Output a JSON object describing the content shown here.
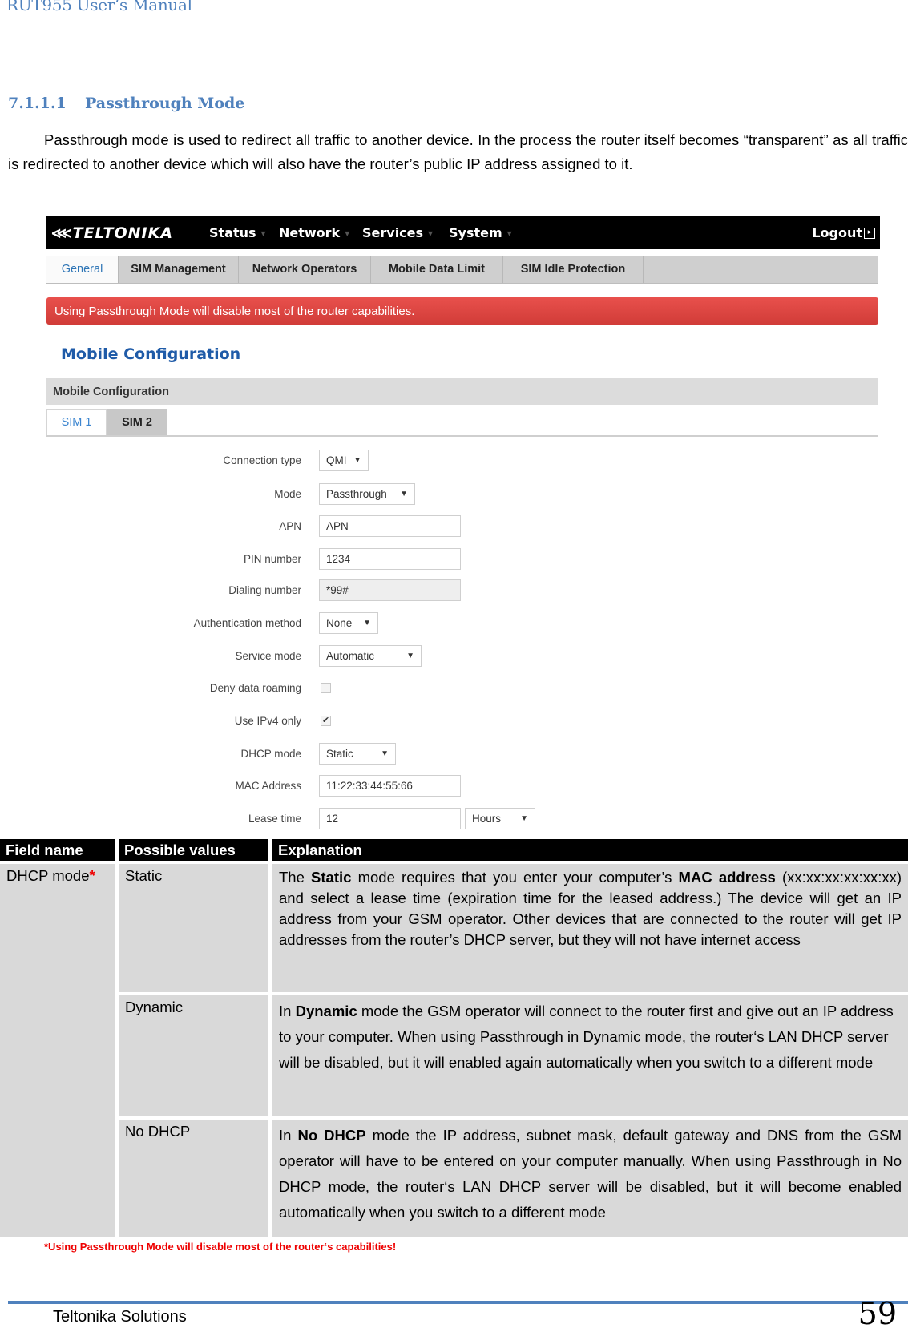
{
  "document": {
    "running_head": "RUT955 User‘s Manual",
    "section_number": "7.1.1.1",
    "section_title": "Passthrough Mode",
    "intro": "Passthrough mode is used to redirect all traffic to another device. In the process the router itself becomes “transparent” as all traffic is redirected to another device which will also have the router’s public IP address assigned to it.",
    "footnote": "*Using Passthrough Mode will disable most of the router‘s capabilities!",
    "footer_company": "Teltonika Solutions",
    "page_number": "59",
    "accent_color": "#4f81bd"
  },
  "router_ui": {
    "brand": "TELTONIKA",
    "nav": [
      {
        "label": "Status",
        "icon": "caret-down-icon"
      },
      {
        "label": "Network",
        "icon": "caret-down-icon"
      },
      {
        "label": "Services",
        "icon": "caret-down-icon"
      },
      {
        "label": "System",
        "icon": "caret-down-icon"
      }
    ],
    "logout": {
      "label": "Logout",
      "icon": "logout-icon"
    },
    "tabs": [
      {
        "label": "General",
        "active": true
      },
      {
        "label": "SIM Management",
        "active": false
      },
      {
        "label": "Network Operators",
        "active": false
      },
      {
        "label": "Mobile Data Limit",
        "active": false
      },
      {
        "label": "SIM Idle Protection",
        "active": false
      }
    ],
    "alert": "Using Passthrough Mode will disable most of the router capabilities.",
    "alert_color": "#d9443f",
    "page_title": "Mobile Configuration",
    "section_title": "Mobile Configuration",
    "sim_tabs": [
      {
        "label": "SIM 1",
        "active": true
      },
      {
        "label": "SIM 2",
        "active": false
      }
    ],
    "form": {
      "connection_type": {
        "label": "Connection type",
        "value": "QMI"
      },
      "mode": {
        "label": "Mode",
        "value": "Passthrough"
      },
      "apn": {
        "label": "APN",
        "value": "APN"
      },
      "pin": {
        "label": "PIN number",
        "value": "1234"
      },
      "dialing": {
        "label": "Dialing number",
        "value": "*99#"
      },
      "auth": {
        "label": "Authentication method",
        "value": "None"
      },
      "service": {
        "label": "Service mode",
        "value": "Automatic"
      },
      "deny_roaming": {
        "label": "Deny data roaming",
        "checked": false
      },
      "ipv4_only": {
        "label": "Use IPv4 only",
        "checked": true,
        "check_glyph": "✔"
      },
      "dhcp_mode": {
        "label": "DHCP mode",
        "value": "Static"
      },
      "mac": {
        "label": "MAC Address",
        "value": "11:22:33:44:55:66"
      },
      "lease": {
        "label": "Lease time",
        "value": "12",
        "unit": "Hours"
      }
    }
  },
  "table": {
    "headers": [
      "Field name",
      "Possible values",
      "Explanation"
    ],
    "field_name": "DHCP mode",
    "field_marker": "*",
    "rows": [
      {
        "value": "Static",
        "exp_pre": "The ",
        "exp_b1": "Static",
        "exp_mid": " mode requires that you enter your computer’s ",
        "exp_b2": "MAC address",
        "exp_post": " (xx:xx:xx:xx:xx:xx) and select a lease time (expiration time for the leased address.) The device will get an IP address from your GSM operator. Other devices that are connected to the router will get IP addresses from the router’s DHCP server, but they will not have internet access"
      },
      {
        "value": "Dynamic",
        "exp_pre": "In ",
        "exp_b1": "Dynamic",
        "exp_post": " mode the GSM operator will connect to the router first and give out an IP address to your computer. When using Passthrough in Dynamic mode, the router‘s LAN DHCP server will be disabled, but it will enabled again automatically when you switch to a different mode"
      },
      {
        "value": "No DHCP",
        "exp_pre": "In ",
        "exp_b1": "No DHCP",
        "exp_post": " mode the IP address, subnet mask, default gateway and DNS from the GSM operator will have to be entered on your computer manually. When using Passthrough in No DHCP mode, the router‘s LAN DHCP server will be disabled, but it will become enabled automatically when you switch to a different mode"
      }
    ]
  }
}
